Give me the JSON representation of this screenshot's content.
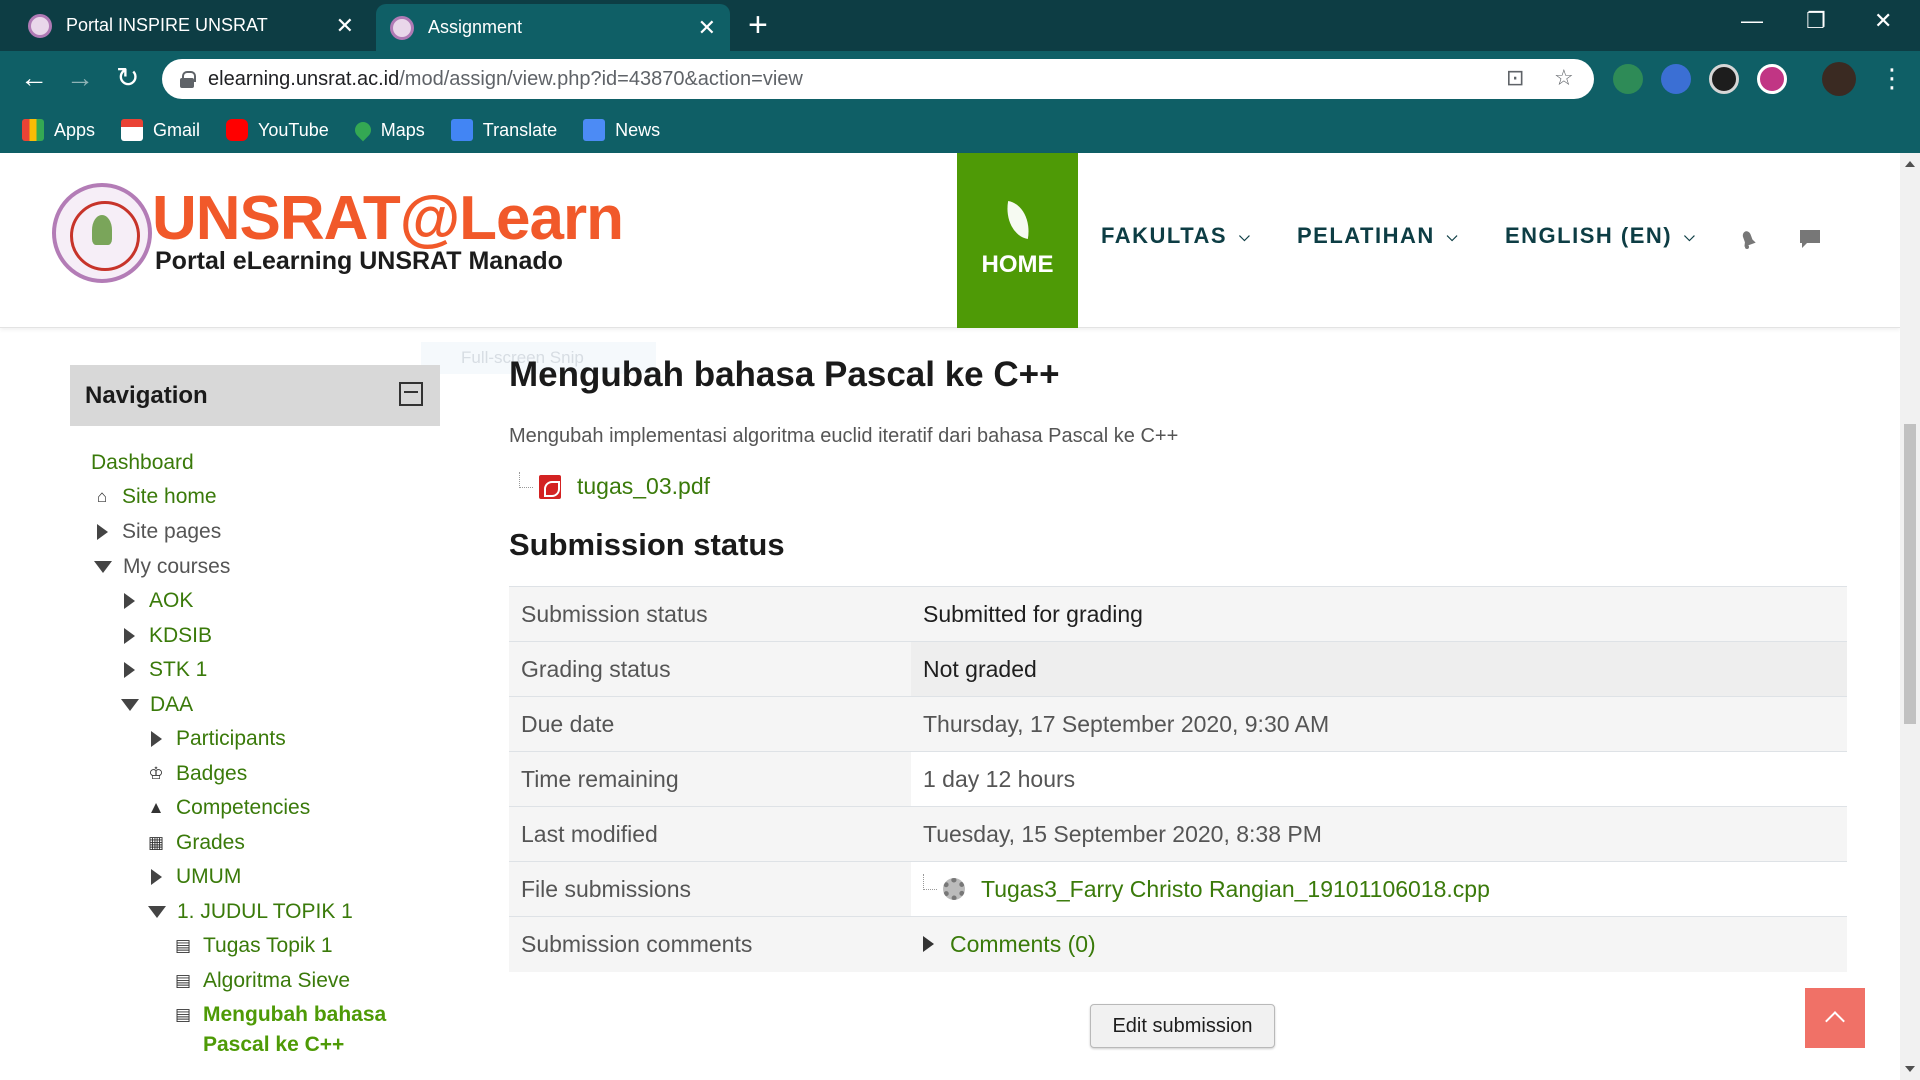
{
  "browser": {
    "tabs": [
      {
        "title": "Portal INSPIRE UNSRAT",
        "active": false
      },
      {
        "title": "Assignment",
        "active": true
      }
    ],
    "url_host": "elearning.unsrat.ac.id",
    "url_path": "/mod/assign/view.php?id=43870&action=view",
    "bookmarks": [
      "Apps",
      "Gmail",
      "YouTube",
      "Maps",
      "Translate",
      "News"
    ]
  },
  "header": {
    "brand_title": "UNSRAT@Learn",
    "brand_subtitle": "Portal eLearning UNSRAT Manado",
    "home_label": "HOME",
    "menu": [
      "FAKULTAS",
      "PELATIHAN",
      "ENGLISH (EN)"
    ],
    "accent_color": "#4e9a06",
    "brand_color": "#f1592a"
  },
  "navigation": {
    "title": "Navigation",
    "items": [
      "Dashboard",
      "Site home",
      "Site pages",
      "My courses",
      "AOK",
      "KDSIB",
      "STK 1",
      "DAA",
      "Participants",
      "Badges",
      "Competencies",
      "Grades",
      "UMUM",
      "1. JUDUL TOPIK 1",
      "Tugas Topik 1",
      "Algoritma Sieve",
      "Mengubah bahasa",
      "Pascal ke C++"
    ]
  },
  "main": {
    "ghost_tooltip": "Full-screen Snip",
    "title": "Mengubah bahasa Pascal ke C++",
    "intro": "Mengubah implementasi algoritma euclid iteratif dari bahasa Pascal ke C++",
    "attachment": "tugas_03.pdf",
    "section_title": "Submission status",
    "rows": [
      {
        "label": "Submission status",
        "value": "Submitted for grading"
      },
      {
        "label": "Grading status",
        "value": "Not graded"
      },
      {
        "label": "Due date",
        "value": "Thursday, 17 September 2020, 9:30 AM"
      },
      {
        "label": "Time remaining",
        "value": "1 day 12 hours"
      },
      {
        "label": "Last modified",
        "value": "Tuesday, 15 September 2020, 8:38 PM"
      },
      {
        "label": "File submissions",
        "value": "Tugas3_Farry Christo Rangian_19101106018.cpp"
      },
      {
        "label": "Submission comments",
        "value": "Comments (0)"
      }
    ],
    "edit_button": "Edit submission"
  }
}
